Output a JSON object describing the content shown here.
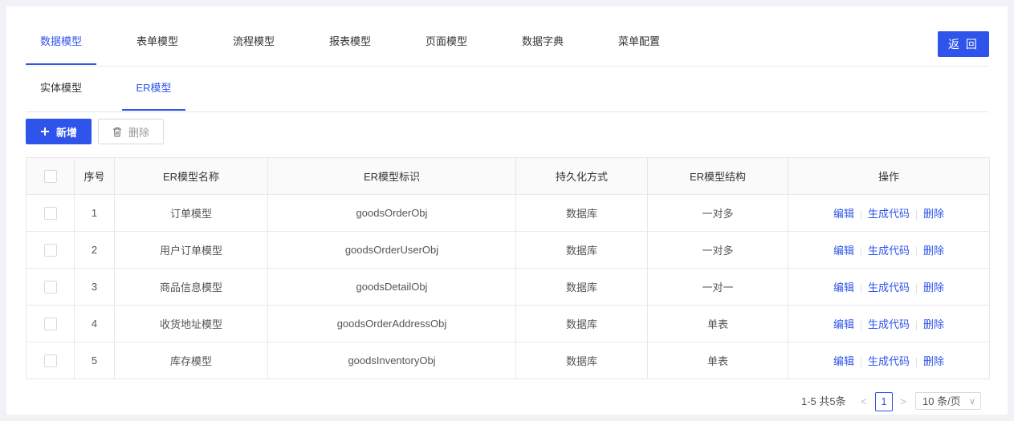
{
  "top_tabs": [
    {
      "label": "数据模型",
      "active": true
    },
    {
      "label": "表单模型",
      "active": false
    },
    {
      "label": "流程模型",
      "active": false
    },
    {
      "label": "报表模型",
      "active": false
    },
    {
      "label": "页面模型",
      "active": false
    },
    {
      "label": "数据字典",
      "active": false
    },
    {
      "label": "菜单配置",
      "active": false
    }
  ],
  "back_label": "返 回",
  "sub_tabs": [
    {
      "label": "实体模型",
      "active": false
    },
    {
      "label": "ER模型",
      "active": true
    }
  ],
  "toolbar": {
    "add_label": "新增",
    "delete_label": "删除"
  },
  "table": {
    "headers": [
      "序号",
      "ER模型名称",
      "ER模型标识",
      "持久化方式",
      "ER模型结构",
      "操作"
    ],
    "rows": [
      {
        "index": "1",
        "name": "订单模型",
        "id": "goodsOrderObj",
        "persist": "数据库",
        "structure": "一对多"
      },
      {
        "index": "2",
        "name": "用户订单模型",
        "id": "goodsOrderUserObj",
        "persist": "数据库",
        "structure": "一对多"
      },
      {
        "index": "3",
        "name": "商品信息模型",
        "id": "goodsDetailObj",
        "persist": "数据库",
        "structure": "一对一"
      },
      {
        "index": "4",
        "name": "收货地址模型",
        "id": "goodsOrderAddressObj",
        "persist": "数据库",
        "structure": "单表"
      },
      {
        "index": "5",
        "name": "库存模型",
        "id": "goodsInventoryObj",
        "persist": "数据库",
        "structure": "单表"
      }
    ],
    "actions": {
      "edit": "编辑",
      "generate": "生成代码",
      "delete": "删除"
    }
  },
  "pagination": {
    "total_text": "1-5 共5条",
    "current_page": "1",
    "page_size": "10 条/页",
    "prev": "<",
    "next": ">"
  },
  "colors": {
    "accent": "#2f54eb"
  },
  "icons": {
    "add": "plus-icon",
    "delete": "trash-icon",
    "dropdown": "chevron-down-icon"
  }
}
